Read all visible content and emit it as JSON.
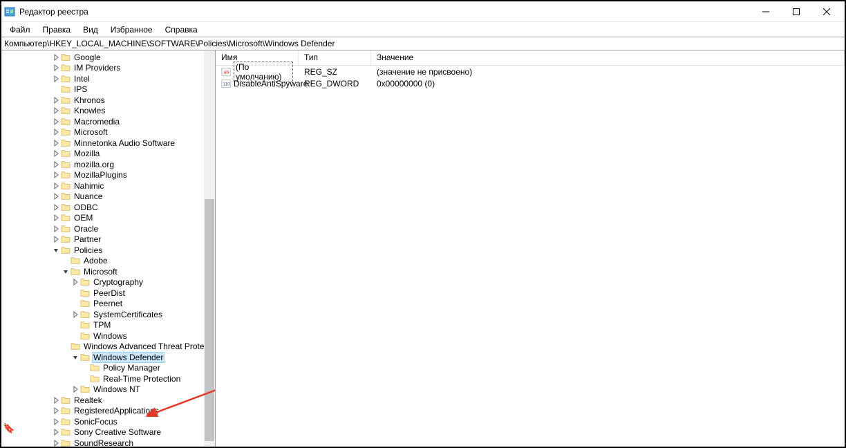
{
  "window": {
    "title": "Редактор реестра"
  },
  "menu": {
    "file": "Файл",
    "edit": "Правка",
    "view": "Вид",
    "favorites": "Избранное",
    "help": "Справка"
  },
  "address": "Компьютер\\HKEY_LOCAL_MACHINE\\SOFTWARE\\Policies\\Microsoft\\Windows Defender",
  "tree": [
    {
      "level": 3,
      "expander": "closed",
      "label": "Google"
    },
    {
      "level": 3,
      "expander": "closed",
      "label": "IM Providers"
    },
    {
      "level": 3,
      "expander": "closed",
      "label": "Intel"
    },
    {
      "level": 3,
      "expander": "none",
      "label": "IPS"
    },
    {
      "level": 3,
      "expander": "closed",
      "label": "Khronos"
    },
    {
      "level": 3,
      "expander": "closed",
      "label": "Knowles"
    },
    {
      "level": 3,
      "expander": "closed",
      "label": "Macromedia"
    },
    {
      "level": 3,
      "expander": "closed",
      "label": "Microsoft"
    },
    {
      "level": 3,
      "expander": "closed",
      "label": "Minnetonka Audio Software"
    },
    {
      "level": 3,
      "expander": "closed",
      "label": "Mozilla"
    },
    {
      "level": 3,
      "expander": "closed",
      "label": "mozilla.org"
    },
    {
      "level": 3,
      "expander": "closed",
      "label": "MozillaPlugins"
    },
    {
      "level": 3,
      "expander": "closed",
      "label": "Nahimic"
    },
    {
      "level": 3,
      "expander": "closed",
      "label": "Nuance"
    },
    {
      "level": 3,
      "expander": "closed",
      "label": "ODBC"
    },
    {
      "level": 3,
      "expander": "closed",
      "label": "OEM"
    },
    {
      "level": 3,
      "expander": "closed",
      "label": "Oracle"
    },
    {
      "level": 3,
      "expander": "closed",
      "label": "Partner"
    },
    {
      "level": 3,
      "expander": "open",
      "label": "Policies"
    },
    {
      "level": 4,
      "expander": "none",
      "label": "Adobe"
    },
    {
      "level": 4,
      "expander": "open",
      "label": "Microsoft"
    },
    {
      "level": 5,
      "expander": "closed",
      "label": "Cryptography"
    },
    {
      "level": 5,
      "expander": "none",
      "label": "PeerDist"
    },
    {
      "level": 5,
      "expander": "none",
      "label": "Peernet"
    },
    {
      "level": 5,
      "expander": "closed",
      "label": "SystemCertificates"
    },
    {
      "level": 5,
      "expander": "none",
      "label": "TPM"
    },
    {
      "level": 5,
      "expander": "none",
      "label": "Windows"
    },
    {
      "level": 5,
      "expander": "none",
      "label": "Windows Advanced Threat Protection"
    },
    {
      "level": 5,
      "expander": "open",
      "label": "Windows Defender",
      "selected": true
    },
    {
      "level": 6,
      "expander": "none",
      "label": "Policy Manager"
    },
    {
      "level": 6,
      "expander": "none",
      "label": "Real-Time Protection"
    },
    {
      "level": 5,
      "expander": "closed",
      "label": "Windows NT"
    },
    {
      "level": 3,
      "expander": "closed",
      "label": "Realtek"
    },
    {
      "level": 3,
      "expander": "closed",
      "label": "RegisteredApplications"
    },
    {
      "level": 3,
      "expander": "closed",
      "label": "SonicFocus"
    },
    {
      "level": 3,
      "expander": "closed",
      "label": "Sony Creative Software"
    },
    {
      "level": 3,
      "expander": "closed",
      "label": "SoundResearch"
    }
  ],
  "list": {
    "columns": {
      "name": "Имя",
      "type": "Тип",
      "data": "Значение"
    },
    "rows": [
      {
        "icon": "string",
        "name": "(По умолчанию)",
        "type": "REG_SZ",
        "data": "(значение не присвоено)",
        "default": true
      },
      {
        "icon": "binary",
        "name": "DisableAntiSpyware",
        "type": "REG_DWORD",
        "data": "0x00000000 (0)",
        "default": false
      }
    ]
  }
}
